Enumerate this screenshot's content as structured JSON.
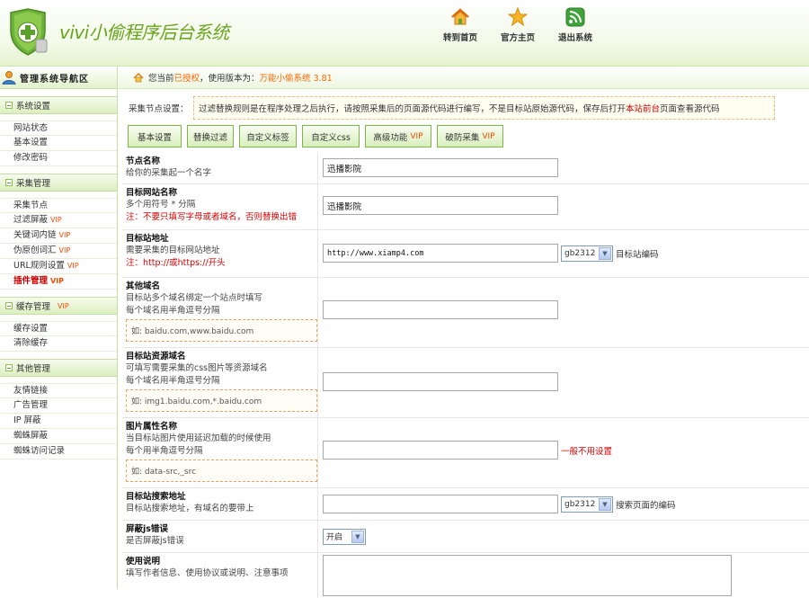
{
  "header": {
    "app_title": "vivi小偷程序后台系统",
    "nav": [
      {
        "label": "转到首页",
        "icon": "home-icon"
      },
      {
        "label": "官方主页",
        "icon": "star-icon"
      },
      {
        "label": "退出系统",
        "icon": "rss-exit-icon"
      }
    ]
  },
  "sidebar": {
    "title": "管理系统导航区",
    "groups": [
      {
        "title": "系统设置",
        "items": [
          {
            "label": "网站状态"
          },
          {
            "label": "基本设置"
          },
          {
            "label": "修改密码"
          }
        ]
      },
      {
        "title": "采集管理",
        "items": [
          {
            "label": "采集节点"
          },
          {
            "label": "过滤屏蔽",
            "vip": "VIP"
          },
          {
            "label": "关键词内链",
            "vip": "VIP"
          },
          {
            "label": "伪原创词汇",
            "vip": "VIP"
          },
          {
            "label": "URL规则设置",
            "vip": "VIP"
          },
          {
            "label": "插件管理",
            "vip": "VIP",
            "active": true
          }
        ]
      },
      {
        "title": "缓存管理",
        "vip": "VIP",
        "items": [
          {
            "label": "缓存设置"
          },
          {
            "label": "清除缓存"
          }
        ]
      },
      {
        "title": "其他管理",
        "items": [
          {
            "label": "友情链接"
          },
          {
            "label": "广告管理"
          },
          {
            "label": "IP 屏蔽"
          },
          {
            "label": "蜘蛛屏蔽"
          },
          {
            "label": "蜘蛛访问记录"
          }
        ]
      }
    ]
  },
  "breadcrumb": {
    "prefix": "您当前",
    "authorized": "已授权",
    "middle": "，使用版本为：",
    "version": "万能小偷系统 3.81"
  },
  "notice": {
    "label": "采集节点设置：",
    "text_before": "过滤替换规则是在程序处理之后执行，请按照采集后的页面源代码进行编写，不是目标站原始源代码，保存后打开",
    "link": "本站前台",
    "text_after": "页面查看源代码"
  },
  "tabs": [
    {
      "label": "基本设置"
    },
    {
      "label": "替换过滤"
    },
    {
      "label": "自定义标签"
    },
    {
      "label": "自定义css"
    },
    {
      "label": "高级功能",
      "vip": "VIP"
    },
    {
      "label": "破防采集",
      "vip": "VIP"
    }
  ],
  "form": {
    "node_name": {
      "title": "节点名称",
      "desc": "给你的采集起一个名字",
      "value": "迅播影院"
    },
    "target_name": {
      "title": "目标网站名称",
      "desc": "多个用符号 * 分隔",
      "warn": "注：不要只填写字母或者域名，否则替换出错",
      "value": "迅播影院"
    },
    "target_url": {
      "title": "目标站地址",
      "desc": "需要采集的目标网站地址",
      "warn": "注：http://或https://开头",
      "value": "http://www.xiamp4.com",
      "encoding": "gb2312",
      "after": "目标站编码"
    },
    "other_domains": {
      "title": "其他域名",
      "desc1": "目标站多个域名绑定一个站点时填写",
      "desc2": "每个域名用半角逗号分隔",
      "example": "如: baidu.com,www.baidu.com",
      "value": ""
    },
    "resource_domains": {
      "title": "目标站资源域名",
      "desc1": "可填写需要采集的css图片等资源域名",
      "desc2": "每个域名用半角逗号分隔",
      "example": "如: img1.baidu.com,*.baidu.com",
      "value": ""
    },
    "image_attr": {
      "title": "图片属性名称",
      "desc1": "当目标站图片使用延迟加载的时候使用",
      "desc2": "每个用半角逗号分隔",
      "example": "如: data-src,_src",
      "value": "",
      "after": "一般不用设置"
    },
    "search_url": {
      "title": "目标站搜索地址",
      "desc": "目标站搜索地址，有域名的要带上",
      "value": "",
      "encoding": "gb2312",
      "after": "搜索页面的编码"
    },
    "block_js": {
      "title": "屏蔽js错误",
      "desc": "是否屏蔽js错误",
      "value": "开启"
    },
    "usage": {
      "title": "使用说明",
      "desc": "填写作者信息、使用协议或说明、注意事项",
      "value": ""
    }
  },
  "colors": {
    "accent_green": "#6aa31e",
    "link_red": "#cc0000",
    "vip_orange": "#ff4a00",
    "crumb_orange": "#ff6600"
  }
}
